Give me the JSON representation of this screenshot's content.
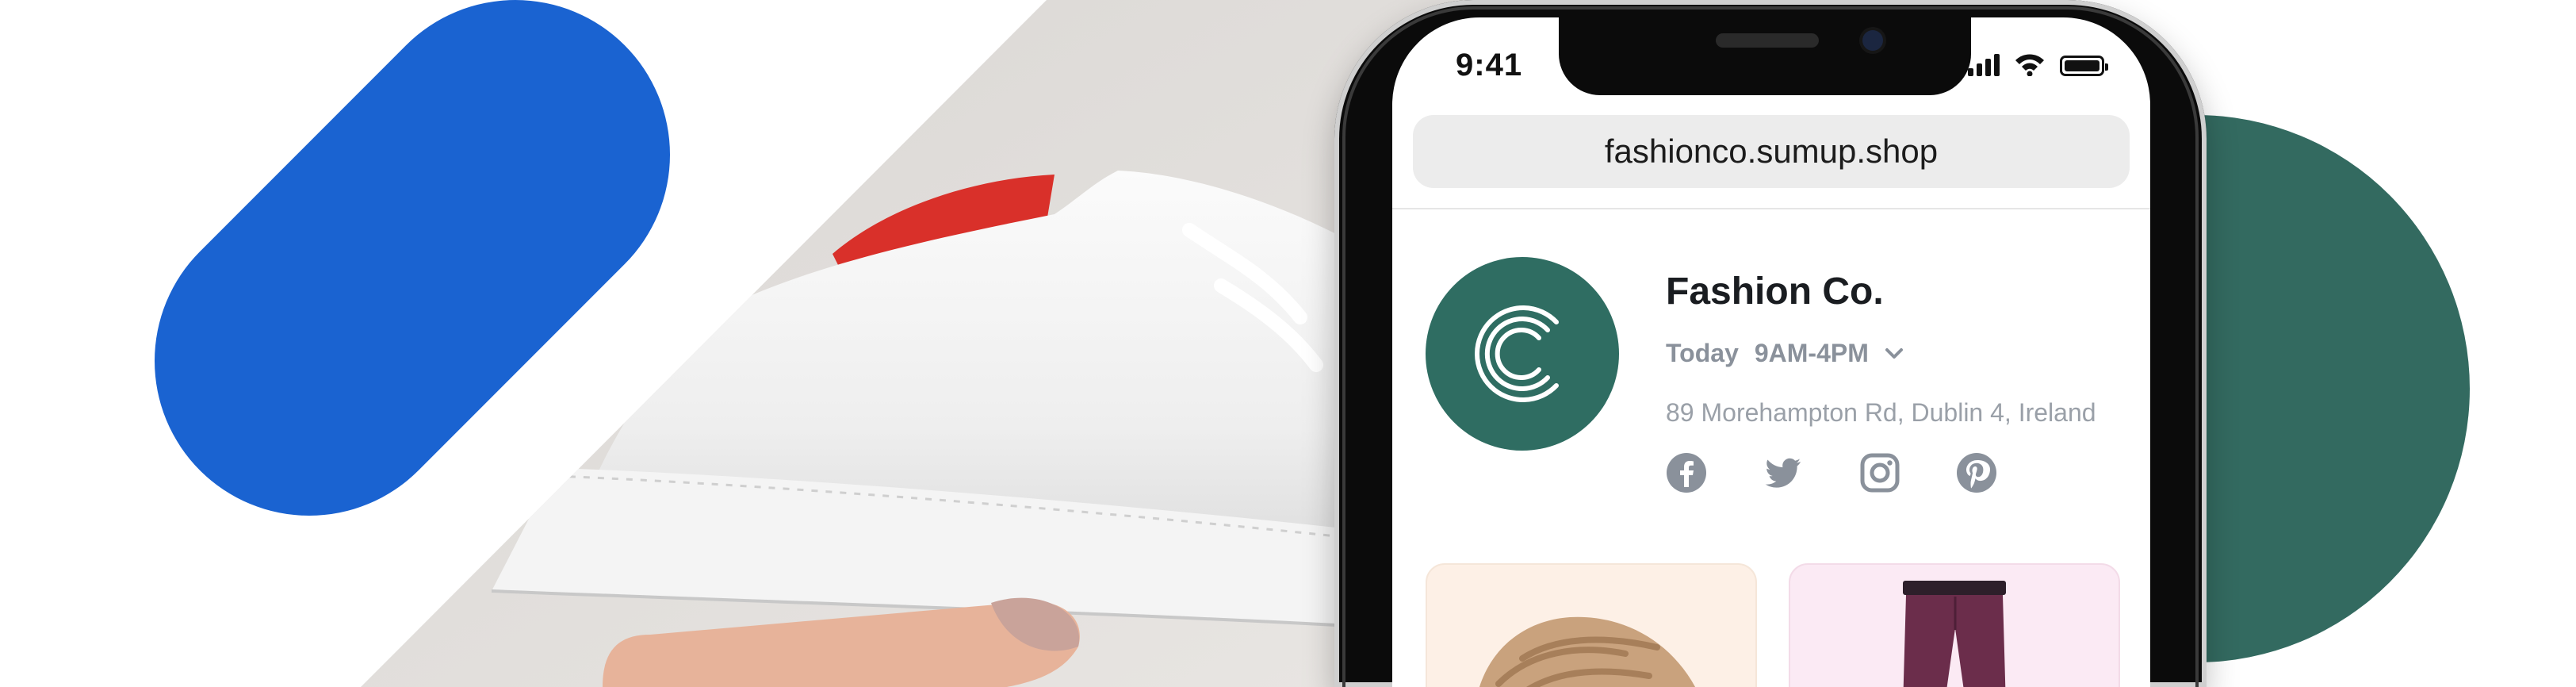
{
  "status_bar": {
    "time": "9:41"
  },
  "browser": {
    "url": "fashionco.sumup.shop"
  },
  "store": {
    "name": "Fashion Co.",
    "day": "Today",
    "hours": "9AM-4PM",
    "address": "89 Morehampton Rd, Dublin 4, Ireland",
    "brand_color": "#2f6d62"
  },
  "socials": [
    {
      "icon": "facebook-icon"
    },
    {
      "icon": "twitter-icon"
    },
    {
      "icon": "instagram-icon"
    },
    {
      "icon": "pinterest-icon"
    }
  ],
  "products": [
    {
      "icon": "knit-scarf-image"
    },
    {
      "icon": "trousers-image"
    }
  ],
  "colors": {
    "accent_blue": "#1a63d1",
    "accent_green": "#336a60",
    "text_muted": "#8a919b"
  }
}
